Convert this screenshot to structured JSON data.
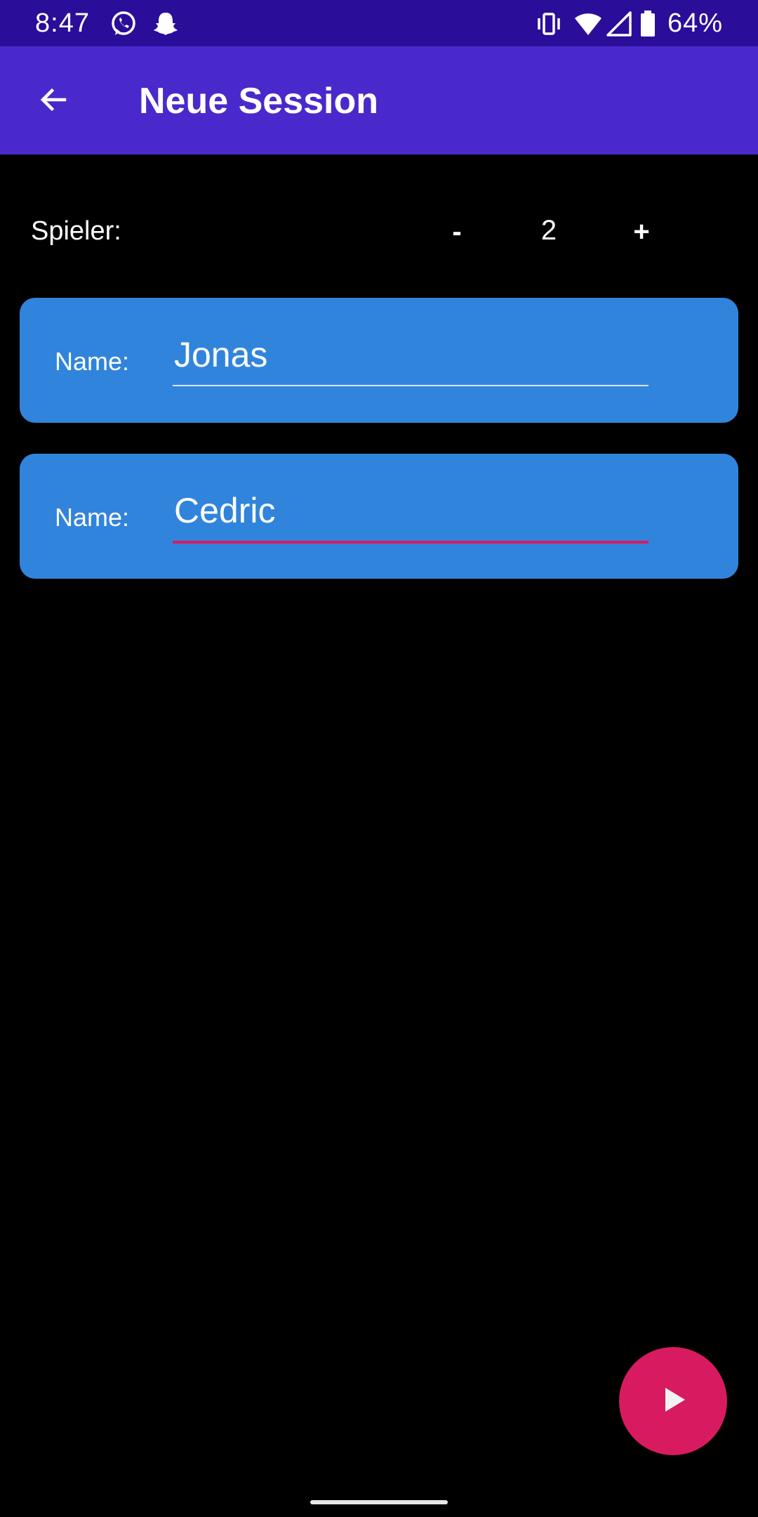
{
  "status_bar": {
    "time": "8:47",
    "battery": "64%",
    "background": "#2A0E99",
    "icons": [
      "whatsapp-icon",
      "snapchat-icon",
      "vibrate-icon",
      "wifi-icon",
      "signal-icon",
      "battery-icon"
    ]
  },
  "app_bar": {
    "title": "Neue Session",
    "back_icon": "back-arrow-icon",
    "background": "#4A29CC"
  },
  "players": {
    "label": "Spieler:",
    "decrement_label": "-",
    "count": "2",
    "increment_label": "+"
  },
  "cards": [
    {
      "label": "Name:",
      "value": "Jonas",
      "focused": false
    },
    {
      "label": "Name:",
      "value": "Cedric",
      "focused": true
    }
  ],
  "colors": {
    "card": "#3184DB",
    "accent": "#D81B60",
    "underline_default": "#D6E6F7",
    "underline_focused": "#D81B60",
    "background": "#000000"
  },
  "fab": {
    "icon": "play-icon"
  }
}
